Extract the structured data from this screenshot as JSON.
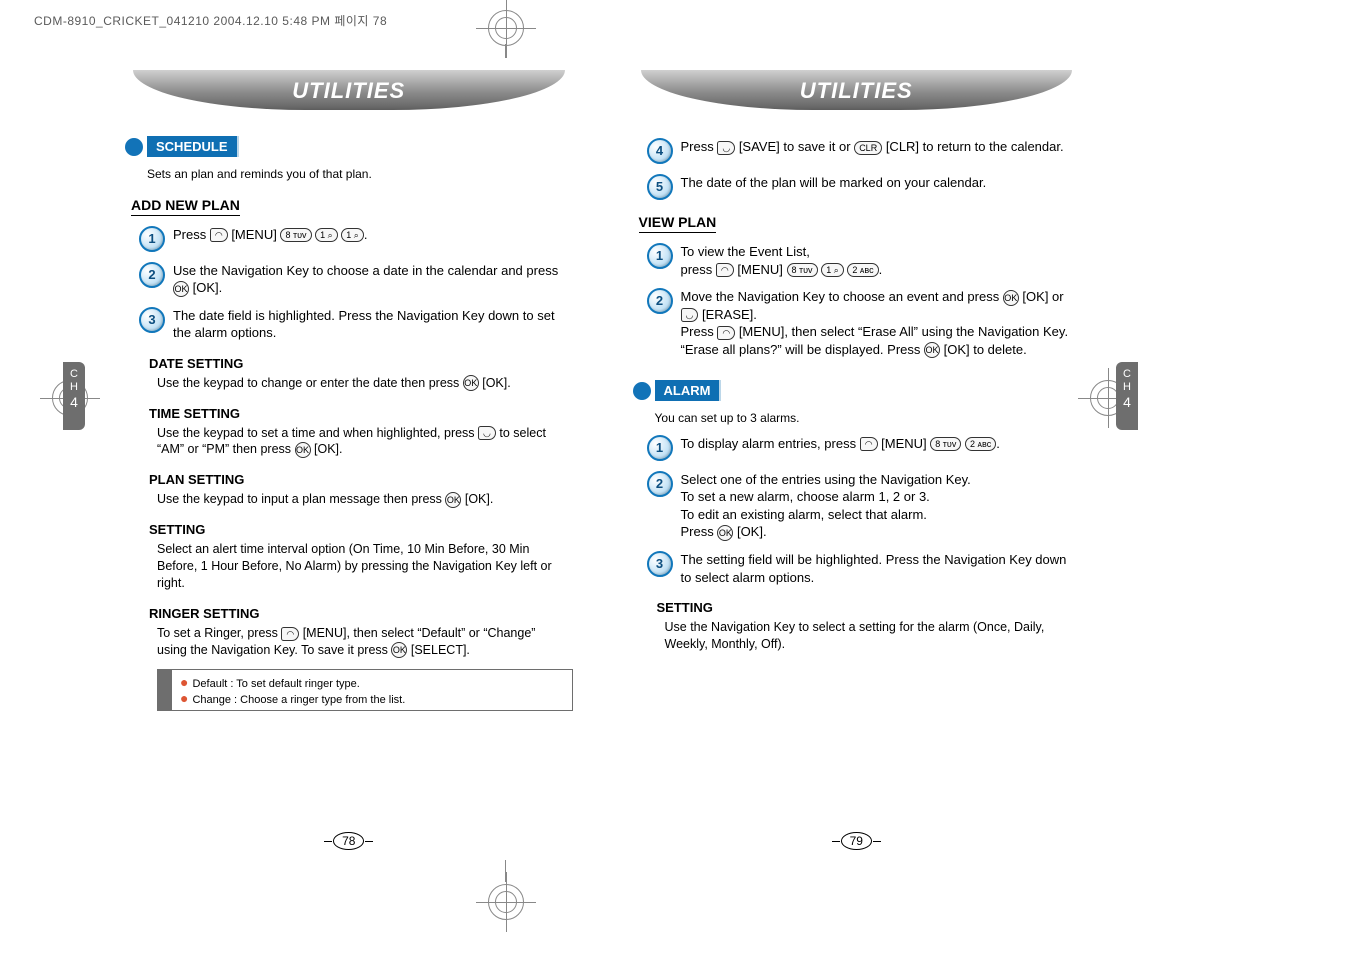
{
  "meta": {
    "header": "CDM-8910_CRICKET_041210  2004.12.10 5:48 PM  페이지 78"
  },
  "left": {
    "title": "UTILITIES",
    "ch_label_line1": "C",
    "ch_label_line2": "H",
    "ch_label_num": "4",
    "schedule_tag": "SCHEDULE",
    "schedule_intro": "Sets an plan and reminds you of that plan.",
    "add_new_plan": "ADD NEW PLAN",
    "step1": "Press       [MENU]                         .",
    "step2": "Use the Navigation Key to choose a date in the calendar and press       [OK].",
    "step3": "The date field is highlighted. Press the Navigation Key down to set the alarm options.",
    "date_setting_h": "DATE SETTING",
    "date_setting": "Use the keypad to change or enter the date then press       [OK].",
    "time_setting_h": "TIME SETTING",
    "time_setting": "Use the keypad to set a time and when highlighted, press       to select “AM” or “PM” then press       [OK].",
    "plan_setting_h": "PLAN SETTING",
    "plan_setting": "Use the keypad to input a plan message then press       [OK].",
    "setting_h": "SETTING",
    "setting_body": "Select an alert time interval option (On Time, 10 Min Before, 30 Min Before, 1 Hour Before, No Alarm) by pressing the Navigation Key left or right.",
    "ringer_h": "RINGER SETTING",
    "ringer_body": "To set a Ringer, press       [MENU], then select “Default” or “Change” using the Navigation Key. To save it press       [SELECT].",
    "note_line1": "Default : To set default ringer type.",
    "note_line2": "Change : Choose a ringer type from the list.",
    "page_num": "78"
  },
  "right": {
    "title": "UTILITIES",
    "ch_label_line1": "C",
    "ch_label_line2": "H",
    "ch_label_num": "4",
    "step4": "Press       [SAVE] to save it or         [CLR] to return to the calendar.",
    "step5": "The date of the plan will be marked on your calendar.",
    "view_plan": "VIEW PLAN",
    "vp_step1": "To view the Event List,\npress       [MENU]                         .",
    "vp_step2": "Move the Navigation Key to choose an event and press       [OK] or       [ERASE].\nPress       [MENU], then select “Erase All” using the Navigation Key.  “Erase all plans?” will be displayed. Press       [OK] to delete.",
    "alarm_tag": "ALARM",
    "alarm_intro": "You can set up to 3 alarms.",
    "al_step1": "To display alarm entries, press       [MENU]               .",
    "al_step2": "Select one of the entries using the Navigation Key.\nTo set a new alarm, choose alarm 1, 2 or 3.\nTo edit an existing alarm, select that alarm.\nPress       [OK].",
    "al_step3": "The setting field will be highlighted. Press the Navigation Key down to select alarm options.",
    "al_setting_h": "SETTING",
    "al_setting_body": "Use the Navigation Key to select a setting for the alarm (Once, Daily, Weekly, Monthly, Off).",
    "page_num": "79"
  }
}
